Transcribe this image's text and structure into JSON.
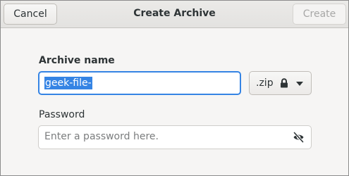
{
  "window": {
    "title": "Create Archive",
    "cancel_label": "Cancel",
    "create_label": "Create"
  },
  "form": {
    "archive_name_label": "Archive name",
    "archive_name_value": "geek-file-",
    "extension": ".zip",
    "password_label": "Password",
    "password_placeholder": "Enter a password here."
  },
  "icons": {
    "lock": "lock-icon",
    "dropdown": "chevron-down-icon",
    "visibility": "eye-crossed-icon"
  },
  "colors": {
    "accent": "#3584e4",
    "window_bg": "#f6f5f4",
    "text": "#2e3436"
  }
}
